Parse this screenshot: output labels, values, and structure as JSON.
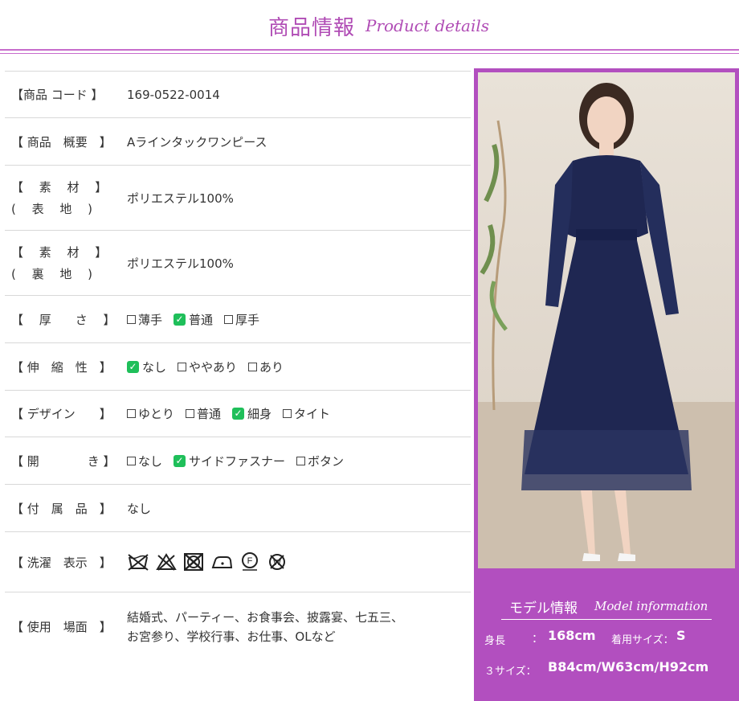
{
  "header": {
    "title": "商品情報",
    "subtitle": "Product details"
  },
  "rows": [
    {
      "label": "【商品 コード 】",
      "value": "169-0522-0014"
    },
    {
      "label": "【 商品　概要　】",
      "value": "Aラインタックワンピース"
    },
    {
      "label1": "【　 素　 材　 】",
      "label2": "(　 表　 地　 )",
      "value": "ポリエステル100%"
    },
    {
      "label1": "【　 素　 材　 】",
      "label2": "(　 裏　 地　 )",
      "value": "ポリエステル100%"
    },
    {
      "label": "【　 厚　　さ　 】",
      "options": [
        "薄手",
        "普通",
        "厚手"
      ]
    },
    {
      "label": "【 伸　縮　性　】",
      "options": [
        "なし",
        "ややあり",
        "あり"
      ]
    },
    {
      "label": "【 デザイン　　】",
      "options": [
        "ゆとり",
        "普通",
        "細身",
        "タイト"
      ]
    },
    {
      "label": "【 開　　　　き 】",
      "options": [
        "なし",
        "サイドファスナー",
        "ボタン"
      ]
    },
    {
      "label": "【 付　属　品　】",
      "value": "なし"
    },
    {
      "label": "【 洗濯　表示　】",
      "icons": [
        "no-wash-icon",
        "no-bleach-icon",
        "no-tumble-dry-icon",
        "iron-low-icon",
        "dry-clean-f-icon",
        "no-wet-clean-icon"
      ]
    },
    {
      "label": "【 使用　場面　】",
      "line1": "結婚式、パーティー、お食事会、披露宴、七五三、",
      "line2": "お宮参り、学校行事、お仕事、OLなど"
    }
  ],
  "model": {
    "title": "モデル情報",
    "subtitle": "Model information",
    "height_label": "身長",
    "colon": "：",
    "height_value": "168cm",
    "size_label": "着用サイズ：",
    "size_value": "S",
    "three_label": "３サイズ：",
    "three_value": "B84cm/W63cm/H92cm"
  },
  "colors": {
    "accent": "#b24fbf",
    "check": "#1fbf5a",
    "dress": "#1f2752"
  }
}
